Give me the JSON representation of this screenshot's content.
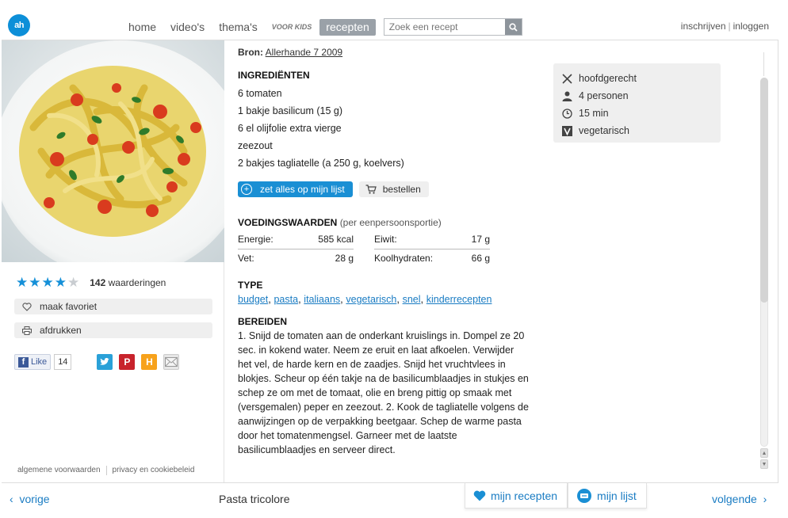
{
  "header": {
    "logo": "ah",
    "nav": [
      "home",
      "video's",
      "thema's"
    ],
    "kids_label": "VOOR KIDS",
    "active_tab": "recepten",
    "search_placeholder": "Zoek een recept",
    "account": {
      "register": "inschrijven",
      "login": "inloggen"
    }
  },
  "sidebar": {
    "rating": {
      "stars": 4,
      "max": 5,
      "count": "142",
      "count_label": "waarderingen"
    },
    "favorite_label": "maak favoriet",
    "print_label": "afdrukken",
    "social": {
      "like_label": "Like",
      "like_count": "14"
    },
    "footer": {
      "terms": "algemene voorwaarden",
      "privacy": "privacy en cookiebeleid"
    }
  },
  "recipe": {
    "source_label": "Bron:",
    "source_value": "Allerhande 7 2009",
    "ingredients_title": "INGREDIËNTEN",
    "ingredients": [
      "6 tomaten",
      "1 bakje basilicum (15 g)",
      "6 el olijfolie extra vierge",
      "zeezout",
      "2 bakjes tagliatelle (a 250 g, koelvers)"
    ],
    "add_to_list_label": "zet alles op mijn lijst",
    "order_label": "bestellen",
    "nutrition_title": "VOEDINGSWAARDEN",
    "nutrition_sub": "(per eenpersoonsportie)",
    "nutrition": [
      {
        "label": "Energie:",
        "value": "585 kcal",
        "label2": "Eiwit:",
        "value2": "17 g"
      },
      {
        "label": "Vet:",
        "value": "28 g",
        "label2": "Koolhydraten:",
        "value2": "66 g"
      }
    ],
    "type_title": "TYPE",
    "types": [
      "budget",
      "pasta",
      "italiaans",
      "vegetarisch",
      "snel",
      "kinderrecepten"
    ],
    "prep_title": "BEREIDEN",
    "prep_text": "1. Snijd de tomaten aan de onderkant kruislings in. Dompel ze 20 sec. in kokend water. Neem ze eruit en laat afkoelen. Verwijder het vel, de harde kern en de zaadjes. Snijd het vruchtvlees in blokjes. Scheur op één takje na de basilicumblaadjes in stukjes en schep ze om met de tomaat, olie en breng pittig op smaak met (versgemalen) peper en zeezout. 2. Kook de tagliatelle volgens de aanwijzingen op de verpakking beetgaar. Schep de warme pasta door het tomatenmengsel. Garneer met de laatste basilicumblaadjes en serveer direct."
  },
  "info": {
    "course": "hoofdgerecht",
    "servings": "4 personen",
    "time": "15 min",
    "diet": "vegetarisch"
  },
  "bottom": {
    "prev": "vorige",
    "recipe_name": "Pasta tricolore",
    "my_recipes": "mijn recepten",
    "my_list": "mijn lijst",
    "next": "volgende"
  },
  "colors": {
    "accent": "#1a8fd4",
    "link": "#1a7cc3",
    "panel": "#efefef"
  }
}
